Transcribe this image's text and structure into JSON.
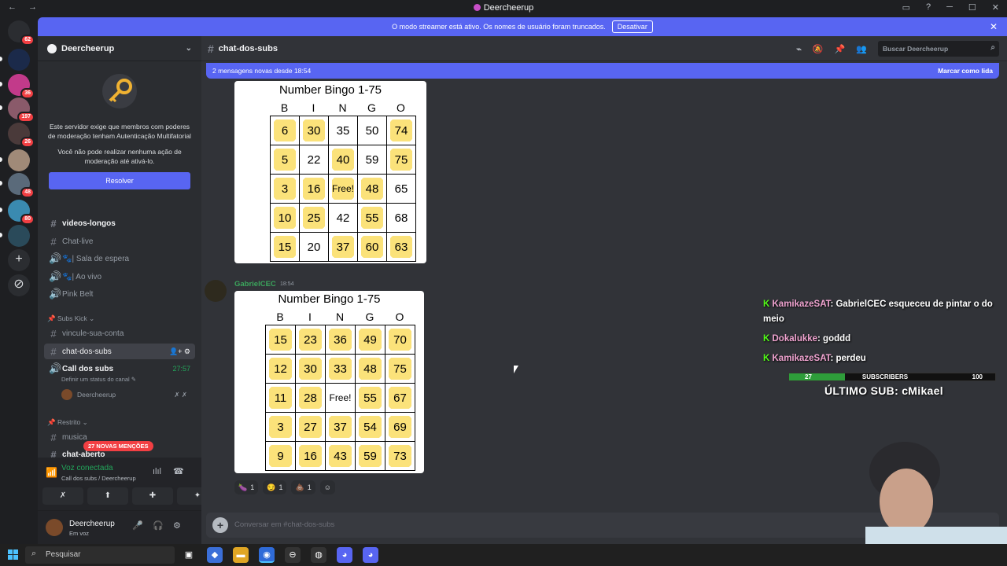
{
  "window": {
    "title": "Deercheerup",
    "nav": "← →",
    "controls": [
      "▭",
      "?",
      "─",
      "☐",
      "✕"
    ]
  },
  "guilds": [
    {
      "badge": "62"
    },
    {
      "badge": ""
    },
    {
      "badge": "36"
    },
    {
      "badge": "197"
    },
    {
      "badge": "26"
    },
    {
      "badge": ""
    },
    {
      "badge": "48"
    },
    {
      "badge": "80"
    },
    {
      "badge": ""
    }
  ],
  "banner": {
    "text": "O modo streamer está ativo. Os nomes de usuário foram truncados.",
    "button": "Desativar",
    "close": "✕"
  },
  "sidebar": {
    "server_name": "Deercheerup",
    "mfa_text_1": "Este servidor exige que membros com poderes de moderação tenham Autenticação Multifatorial",
    "mfa_text_2": "Você não pode realizar nenhuma ação de moderação até ativá-lo.",
    "resolve": "Resolver",
    "channels": [
      {
        "name": "videos-longos",
        "icon": "#",
        "unread": true
      },
      {
        "name": "Chat-live",
        "icon": "#",
        "unread": false
      },
      {
        "name": "🐾| Sala de espera",
        "icon": "🔊",
        "unread": false
      },
      {
        "name": "🐾| Ao vivo",
        "icon": "🔊",
        "unread": false
      },
      {
        "name": "Pink Belt",
        "icon": "🔊",
        "unread": false
      }
    ],
    "category_1": "Subs Kick",
    "channels_2": [
      {
        "name": "vincule-sua-conta",
        "icon": "#"
      },
      {
        "name": "chat-dos-subs",
        "icon": "#"
      },
      {
        "name": "Call dos subs",
        "icon": "🔊",
        "timer": "27:57"
      }
    ],
    "call_status": "Definir um status do canal",
    "call_member": "Deercheerup",
    "category_2": "Restrito",
    "channels_3": [
      {
        "name": "musica"
      },
      {
        "name": "chat-aberto"
      }
    ],
    "mentions_badge": "27 NOVAS MENÇÕES",
    "voice": {
      "status": "Voz conectada",
      "sub": "Call dos subs / Deercheerup"
    },
    "user": {
      "name": "Deercheerup",
      "status": "Em voz"
    }
  },
  "channel": {
    "name": "chat-dos-subs",
    "search_placeholder": "Buscar Deercheerup",
    "new_messages": "2 mensagens novas desde 18:54",
    "mark_read": "Marcar como lida",
    "composer_placeholder": "Conversar em #chat-dos-subs"
  },
  "bingo_1": {
    "title": "Number Bingo 1-75",
    "letters": [
      "B",
      "I",
      "N",
      "G",
      "O"
    ],
    "rows": [
      [
        "6",
        "30",
        "35",
        "50",
        "74"
      ],
      [
        "5",
        "22",
        "40",
        "59",
        "75"
      ],
      [
        "3",
        "16",
        "Free!",
        "48",
        "65"
      ],
      [
        "10",
        "25",
        "42",
        "55",
        "68"
      ],
      [
        "15",
        "20",
        "37",
        "60",
        "63"
      ]
    ],
    "marked": [
      [
        1,
        1,
        0,
        0,
        1
      ],
      [
        1,
        0,
        1,
        0,
        1
      ],
      [
        1,
        1,
        1,
        1,
        0
      ],
      [
        1,
        1,
        0,
        1,
        0
      ],
      [
        1,
        0,
        1,
        1,
        1
      ]
    ]
  },
  "message_2": {
    "author": "GabrielCEC",
    "time": "18:54"
  },
  "bingo_2": {
    "title": "Number Bingo 1-75",
    "letters": [
      "B",
      "I",
      "N",
      "G",
      "O"
    ],
    "rows": [
      [
        "15",
        "23",
        "36",
        "49",
        "70"
      ],
      [
        "12",
        "30",
        "33",
        "48",
        "75"
      ],
      [
        "11",
        "28",
        "Free!",
        "55",
        "67"
      ],
      [
        "3",
        "27",
        "37",
        "54",
        "69"
      ],
      [
        "9",
        "16",
        "43",
        "59",
        "73"
      ]
    ],
    "marked": [
      [
        1,
        1,
        1,
        1,
        1
      ],
      [
        1,
        1,
        1,
        1,
        1
      ],
      [
        1,
        1,
        0,
        1,
        1
      ],
      [
        1,
        1,
        1,
        1,
        1
      ],
      [
        1,
        1,
        1,
        1,
        1
      ]
    ]
  },
  "reactions": [
    {
      "emoji": "🍆",
      "count": "1"
    },
    {
      "emoji": "😏",
      "count": "1"
    },
    {
      "emoji": "💩",
      "count": "1"
    }
  ],
  "overlay": {
    "chat": [
      {
        "nick": "KamikazeSAT",
        "text": ": GabrielCEC esqueceu de pintar o do meio"
      },
      {
        "nick": "Dokalukke",
        "text": ": goddd"
      },
      {
        "nick": "KamikazeSAT",
        "text": ": perdeu"
      }
    ],
    "sub_current": "27",
    "sub_label": "SUBSCRIBERS",
    "sub_goal": "100",
    "sub_progress": 0.27,
    "last_sub": "ÚLTIMO SUB: cMikael"
  },
  "taskbar": {
    "search": "Pesquisar"
  },
  "colors": {
    "blurple": "#5865f2",
    "green": "#23a55a",
    "red": "#f23f43",
    "bingo_mark": "#fbe27a"
  }
}
